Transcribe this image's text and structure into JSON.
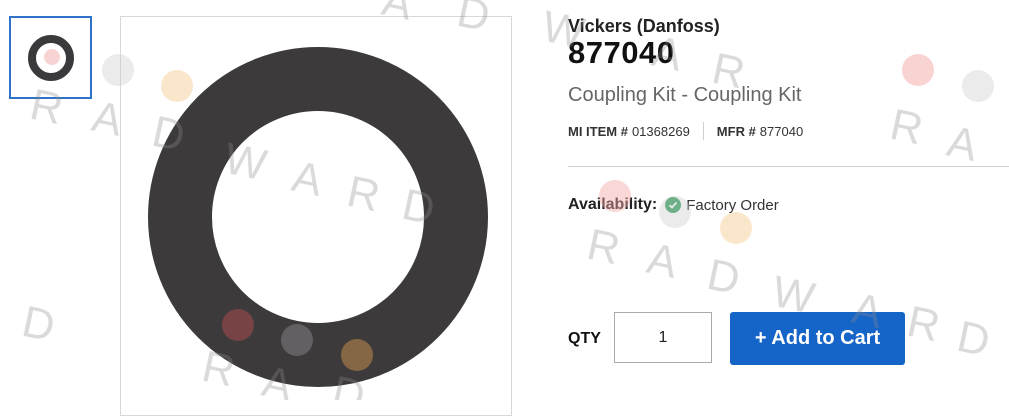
{
  "product": {
    "brand": "Vickers (Danfoss)",
    "part_number": "877040",
    "description": "Coupling Kit - Coupling Kit",
    "mi_item_label": "MI ITEM #",
    "mi_item_value": "01368269",
    "mfr_label": "MFR #",
    "mfr_value": "877040"
  },
  "availability": {
    "label": "Availability:",
    "value": "Factory Order",
    "status_color": "#2e9d5a"
  },
  "purchase": {
    "qty_label": "QTY",
    "qty_value": "1",
    "add_to_cart_label": "+ Add to Cart",
    "button_color": "#1565c8"
  },
  "watermark": {
    "text": "RADWARD"
  }
}
